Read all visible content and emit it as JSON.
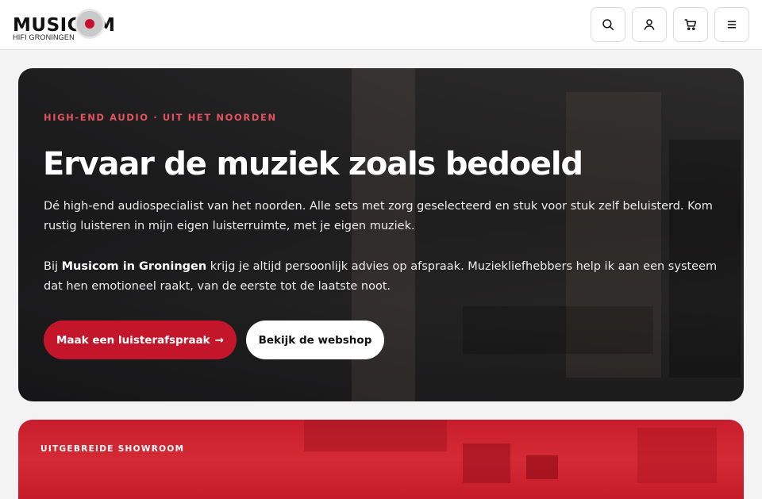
{
  "header": {
    "logo_text": "MUSICOM",
    "logo_sub": "HIFI GRONINGEN",
    "icons": [
      "search-icon",
      "user-icon",
      "cart-icon",
      "menu-icon"
    ]
  },
  "hero": {
    "eyebrow": "HIGH-END AUDIO · UIT HET NOORDEN",
    "title": "Ervaar de muziek zoals bedoeld",
    "paragraph1": "Dé high-end audiospecialist van het noorden. Alle sets met zorg geselecteerd en stuk voor stuk zelf beluisterd. Kom rustig luisteren in mijn eigen luisterruimte, met je eigen muziek.",
    "paragraph2_prefix": "Bij ",
    "paragraph2_bold": "Musicom in Groningen",
    "paragraph2_suffix": " krijg je altijd persoonlijk advies op afspraak. Muziekliefhebbers help ik aan een systeem dat hen emotioneel raakt, van de eerste tot de laatste noot.",
    "primary_button": "Maak een luisterafspraak",
    "primary_arrow": "→",
    "secondary_button": "Bekijk de webshop"
  },
  "section2": {
    "label": "UITGEBREIDE SHOWROOM"
  },
  "colors": {
    "accent": "#c3162a",
    "eyebrow": "#e0545f",
    "hero_bg": "#2a2826"
  }
}
